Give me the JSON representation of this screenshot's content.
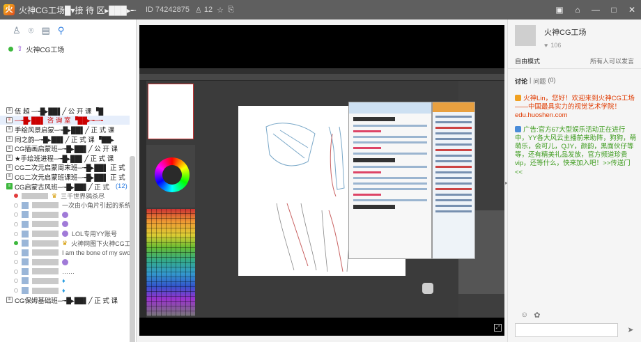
{
  "window": {
    "title": "火神CG工场█▾接 待 区▸███▸╾",
    "room_id": "ID 74242875",
    "member_count": "12"
  },
  "colors": {
    "titlebar": "#5f5f5f",
    "accent_blue": "#2a7be0",
    "message_red": "#e03a00",
    "ad_green": "#3a9a1a"
  },
  "left": {
    "toolbar_icons": [
      "contacts-icon",
      "location-icon",
      "bookmark-icon",
      "search-icon"
    ],
    "top_group": "火神CG工场",
    "channels": [
      {
        "label": "伍 超 ─╼█▸██▌╱ 公 开 课 ▝█",
        "selected": false
      },
      {
        "label": "─╼█▸██▌ 咨 询 室 ▝██▸╼─╼",
        "selected": true
      },
      {
        "label": "手绘风景启蒙─╼█▸██▌╱ 正 式 课",
        "selected": false
      },
      {
        "label": "同之韵─╼█▸██▌╱ 正 式 课 ▝██▸",
        "selected": false
      },
      {
        "label": "CG插画启蒙班─╼█▸██▌╱ 公 开 课",
        "selected": false
      },
      {
        "label": "★手绘班进程─╼█▸██▌╱ 正 式 课",
        "selected": false
      },
      {
        "label": "CG二次元启蒙周末班─╼█▸██▌ 正 式",
        "selected": false
      },
      {
        "label": "CG二次元启蒙班课班─╼█▸██▌ 正 式",
        "selected": false
      }
    ],
    "active_channel": {
      "label": "CG启蒙古风班─╼█▸██▌╱ 正 式",
      "count": "(12)"
    },
    "members": [
      {
        "text": "三千世界鸦杀尽",
        "status": "red"
      },
      {
        "text": "一次由小角片引起的系统崩溃",
        "status": ""
      },
      {
        "text": "",
        "status": ""
      },
      {
        "text": "",
        "status": ""
      },
      {
        "text": "LOL专用YY账号",
        "status": ""
      },
      {
        "text": "火神网图下火神CG工场",
        "status": "on"
      },
      {
        "text": "I am the bone of my swo",
        "status": ""
      },
      {
        "text": "",
        "status": ""
      },
      {
        "text": "……",
        "status": ""
      },
      {
        "text": "",
        "status": ""
      },
      {
        "text": "",
        "status": ""
      }
    ],
    "last_channel": "CG保姆基础班─╼█▸██▌╱ 正 式 课"
  },
  "right": {
    "name": "火神CG工场",
    "likes": "106",
    "mode_label": "自由模式",
    "mode_desc": "所有人可以发言",
    "tab_discuss": "讨论",
    "tab_sep": "|",
    "tab_question": "问题",
    "tab_question_count": "(0)",
    "message_welcome": "火神Lin，您好！欢迎来到火神CG工场——中国最具实力的视觉艺术学院！edu.huoshen.com",
    "message_ad": "广告:官方67大型娱乐活动正在进行中，YY各大风云主播前来助阵，狗狗，萌萌乐，会可儿，QJY，颜韵，黑面伙仔等等，还有精美礼品发放，官方频道珍贵vip，还等什么，快来加入吧！>>传送门<<"
  }
}
